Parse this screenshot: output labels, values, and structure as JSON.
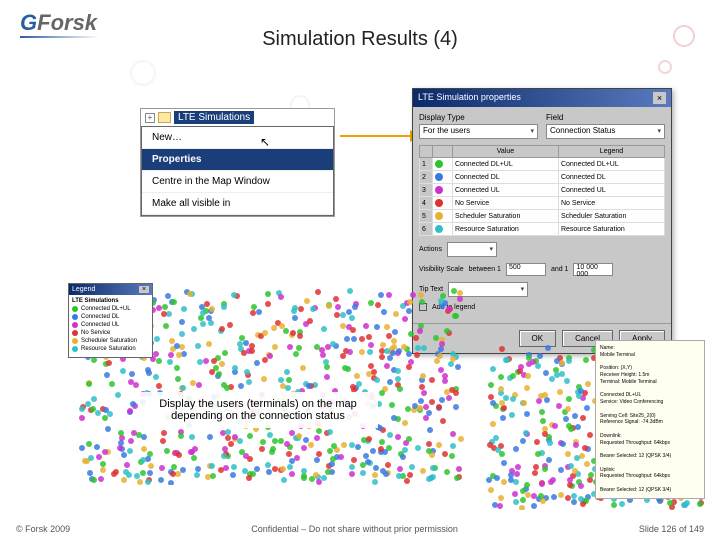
{
  "logo": {
    "first": "G",
    "rest": "Forsk"
  },
  "title": "Simulation Results (4)",
  "tree": {
    "label": "LTE Simulations",
    "menu": [
      "New…",
      "Properties",
      "Centre in the Map Window",
      "Make all visible in"
    ],
    "highlighted": 1
  },
  "dialog": {
    "title": "LTE Simulation properties",
    "display_type_label": "Display Type",
    "display_type": "For the users",
    "field_label": "Field",
    "field": "Connection Status",
    "table": {
      "headers": [
        "",
        "",
        "Value",
        "Legend"
      ],
      "rows": [
        {
          "n": "1",
          "c": "#2dc42d",
          "val": "Connected DL+UL",
          "leg": "Connected DL+UL"
        },
        {
          "n": "2",
          "c": "#3a7ae0",
          "val": "Connected DL",
          "leg": "Connected DL"
        },
        {
          "n": "3",
          "c": "#cf2fcf",
          "val": "Connected UL",
          "leg": "Connected UL"
        },
        {
          "n": "4",
          "c": "#e03030",
          "val": "No Service",
          "leg": "No Service"
        },
        {
          "n": "5",
          "c": "#e8b030",
          "val": "Scheduler Saturation",
          "leg": "Scheduler Saturation"
        },
        {
          "n": "6",
          "c": "#30c0c8",
          "val": "Resource Saturation",
          "leg": "Resource Saturation"
        }
      ]
    },
    "actions_label": "Actions",
    "scale_label": "Visibility Scale",
    "between": "between 1",
    "and": "and 1",
    "v1": "500",
    "v2": "10 000 000",
    "tips_label": "Tip Text",
    "addlegend": "Add to legend",
    "buttons": [
      "OK",
      "Cancel",
      "Apply"
    ]
  },
  "legend": {
    "title": "Legend",
    "subtitle": "LTE Simulations",
    "items": [
      {
        "c": "#2dc42d",
        "t": "Connected DL+UL"
      },
      {
        "c": "#3a7ae0",
        "t": "Connected DL"
      },
      {
        "c": "#cf2fcf",
        "t": "Connected UL"
      },
      {
        "c": "#e03030",
        "t": "No Service"
      },
      {
        "c": "#e8b030",
        "t": "Scheduler Saturation"
      },
      {
        "c": "#30c0c8",
        "t": "Resource Saturation"
      }
    ]
  },
  "info_lines": [
    "Name:",
    "Mobile Terminal",
    "",
    "Position: (X,Y)",
    "Receiver Height: 1.5m",
    "Terminal: Mobile Terminal",
    "",
    "Connected DL+UL",
    "Service: Video Conferencing",
    "",
    "Serving Cell: Site25_2(0)",
    "Reference Signal: -74.3dBm",
    "",
    "Downlink:",
    "Requested Throughput: 64kbps",
    "",
    "Bearer Selected: 12 (QPSK 3/4)",
    "",
    "Uplink:",
    "Requested Throughput: 64kbps",
    "",
    "Bearer Selected: 12 (QPSK 3/4)"
  ],
  "caption": "Display the users (terminals) on the map depending on the connection status",
  "footer": {
    "left": "© Forsk 2009",
    "mid": "Confidential – Do not share without prior permission",
    "right": "Slide 126 of 149"
  }
}
